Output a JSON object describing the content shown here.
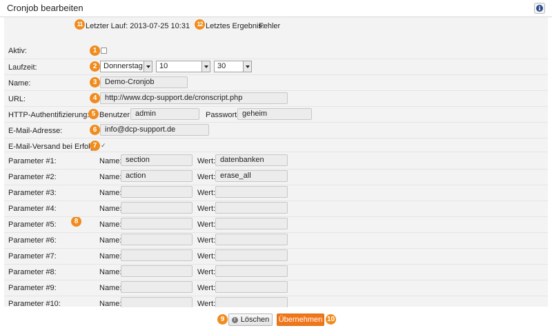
{
  "header": {
    "title": "Cronjob bearbeiten",
    "info_icon": "info-icon"
  },
  "summary": {
    "last_run_badge": "11",
    "last_run": "Letzter Lauf: 2013-07-25 10:31",
    "last_result_badge": "12",
    "last_result_label": "Letztes Ergebnis:",
    "last_result_value": "Fehler"
  },
  "form": {
    "active": {
      "label": "Aktiv:",
      "badge": "1",
      "checked": false
    },
    "runtime": {
      "label": "Laufzeit:",
      "badge": "2",
      "day": "Donnerstag",
      "hour": "10",
      "minute": "30"
    },
    "name": {
      "label": "Name:",
      "badge": "3",
      "value": "Demo-Cronjob"
    },
    "url": {
      "label": "URL:",
      "badge": "4",
      "value": "http://www.dcp-support.de/cronscript.php"
    },
    "http_auth": {
      "label": "HTTP-Authentifizierung:",
      "badge": "5",
      "user_label": "Benutzer:",
      "user_value": "admin",
      "password_label": "Passwort:",
      "password_value": "geheim"
    },
    "email": {
      "label": "E-Mail-Adresse:",
      "badge": "6",
      "value": "info@dcp-support.de"
    },
    "email_on_success": {
      "label": "E-Mail-Versand bei Erfolg:",
      "badge": "7",
      "checked": true
    },
    "params_badge": "8",
    "param_name_label": "Name:",
    "param_value_label": "Wert:",
    "params": [
      {
        "label": "Parameter #1:",
        "name": "section",
        "value": "datenbanken"
      },
      {
        "label": "Parameter #2:",
        "name": "action",
        "value": "erase_all"
      },
      {
        "label": "Parameter #3:",
        "name": "",
        "value": ""
      },
      {
        "label": "Parameter #4:",
        "name": "",
        "value": ""
      },
      {
        "label": "Parameter #5:",
        "name": "",
        "value": ""
      },
      {
        "label": "Parameter #6:",
        "name": "",
        "value": ""
      },
      {
        "label": "Parameter #7:",
        "name": "",
        "value": ""
      },
      {
        "label": "Parameter #8:",
        "name": "",
        "value": ""
      },
      {
        "label": "Parameter #9:",
        "name": "",
        "value": ""
      },
      {
        "label": "Parameter #10:",
        "name": "",
        "value": ""
      }
    ]
  },
  "actions": {
    "delete_badge": "9",
    "delete_label": "Löschen",
    "apply_label": "Übernehmen",
    "apply_badge": "10"
  },
  "colors": {
    "accent": "#f08c1d",
    "button": "#f0761a",
    "panel": "#f3f3f3"
  }
}
